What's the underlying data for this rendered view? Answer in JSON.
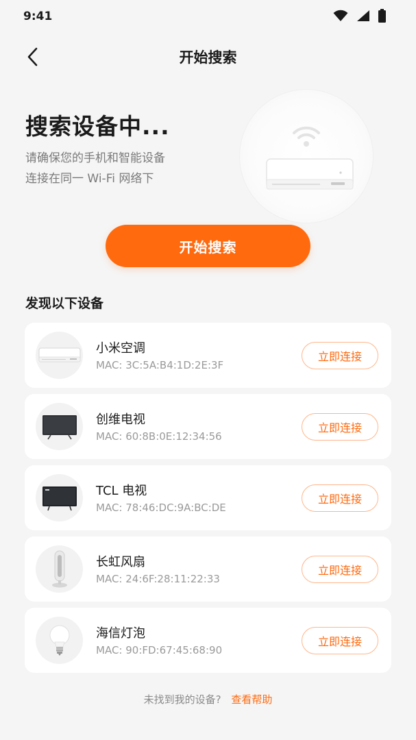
{
  "status_bar": {
    "time": "9:41"
  },
  "nav": {
    "title": "开始搜索"
  },
  "hero": {
    "title": "搜索设备中...",
    "subtitle_line1": "请确保您的手机和智能设备",
    "subtitle_line2": "连接在同一 Wi-Fi 网络下"
  },
  "primary_button": {
    "label": "开始搜索"
  },
  "section": {
    "title": "发现以下设备"
  },
  "devices": [
    {
      "name": "小米空调",
      "mac": "MAC: 3C:5A:B4:1D:2E:3F",
      "connect_label": "立即连接",
      "icon": "air-conditioner-icon"
    },
    {
      "name": "创维电视",
      "mac": "MAC: 60:8B:0E:12:34:56",
      "connect_label": "立即连接",
      "icon": "tv-icon"
    },
    {
      "name": "TCL 电视",
      "mac": "MAC: 78:46:DC:9A:BC:DE",
      "connect_label": "立即连接",
      "icon": "tv-icon"
    },
    {
      "name": "长虹风扇",
      "mac": "MAC: 24:6F:28:11:22:33",
      "connect_label": "立即连接",
      "icon": "tower-fan-icon"
    },
    {
      "name": "海信灯泡",
      "mac": "MAC: 90:FD:67:45:68:90",
      "connect_label": "立即连接",
      "icon": "light-bulb-icon"
    }
  ],
  "footer": {
    "hint": "未找到我的设备?",
    "help_link": "查看帮助"
  },
  "colors": {
    "accent": "#ff6a0f",
    "background": "#f5f5f5",
    "card": "#ffffff"
  }
}
